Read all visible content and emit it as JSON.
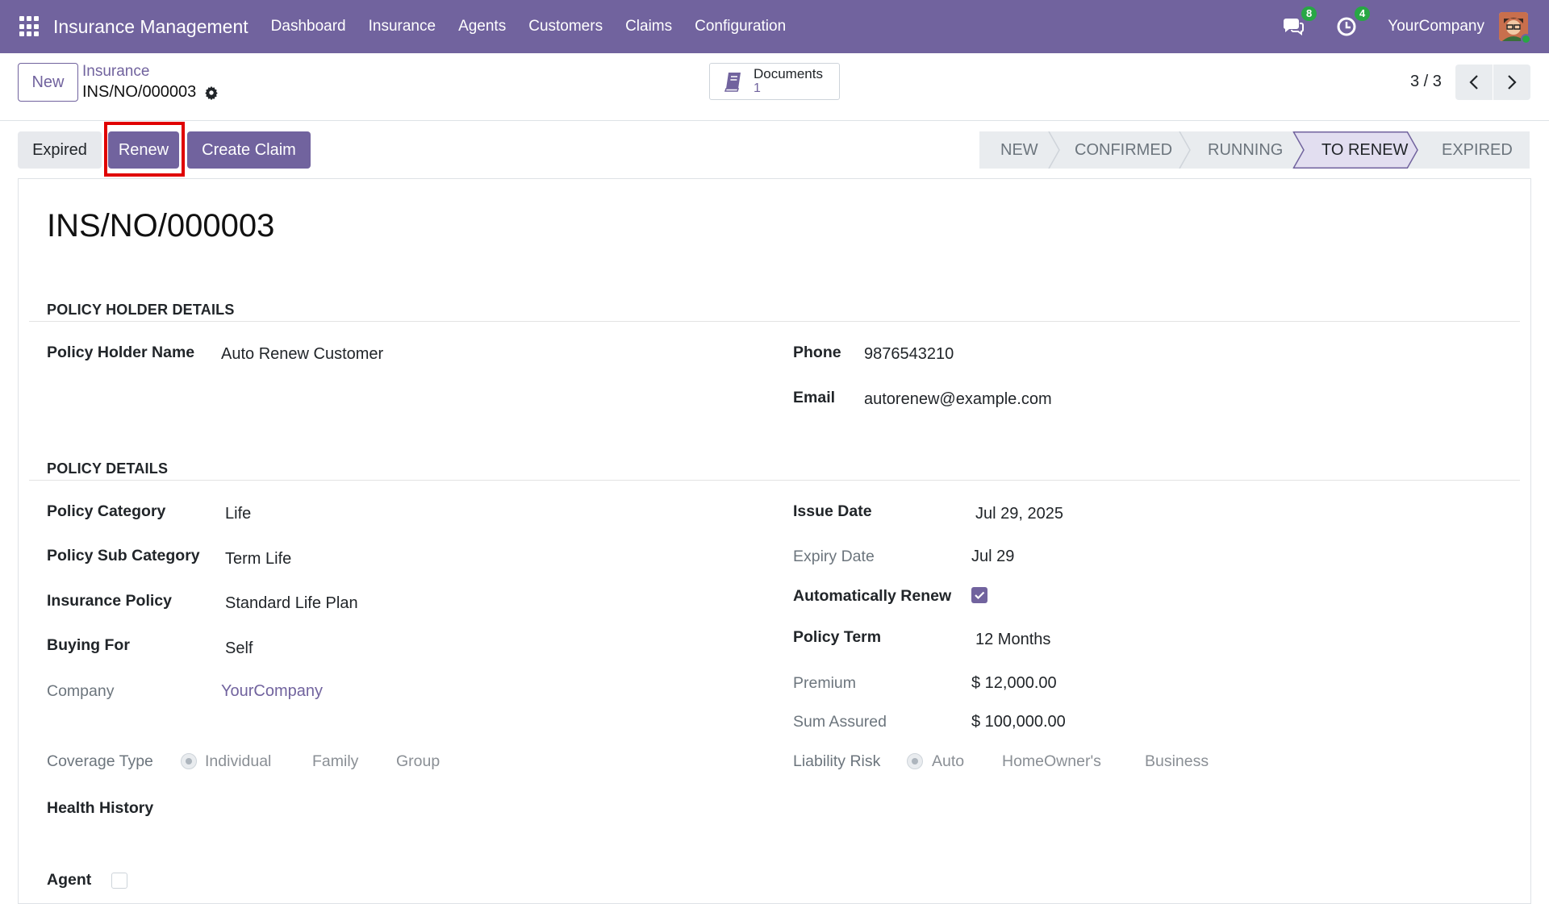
{
  "navbar": {
    "brand": "Insurance Management",
    "menu": [
      "Dashboard",
      "Insurance",
      "Agents",
      "Customers",
      "Claims",
      "Configuration"
    ],
    "messages_count": "8",
    "activities_count": "4",
    "company": "YourCompany"
  },
  "control": {
    "new_label": "New",
    "breadcrumb": "Insurance",
    "record_name": "INS/NO/000003",
    "documents_label": "Documents",
    "documents_count": "1",
    "pager": "3 / 3"
  },
  "actions": {
    "expired": "Expired",
    "renew": "Renew",
    "create_claim": "Create Claim"
  },
  "statusbar": {
    "stages": [
      "NEW",
      "CONFIRMED",
      "RUNNING",
      "TO RENEW",
      "EXPIRED"
    ],
    "active": "TO RENEW"
  },
  "form": {
    "title": "INS/NO/000003",
    "policy_holder_section": "POLICY HOLDER DETAILS",
    "holder_name_label": "Policy Holder Name",
    "holder_name": "Auto Renew Customer",
    "phone_label": "Phone",
    "phone": "9876543210",
    "email_label": "Email",
    "email": "autorenew@example.com",
    "policy_section": "POLICY DETAILS",
    "category_label": "Policy Category",
    "category": "Life",
    "sub_category_label": "Policy Sub Category",
    "sub_category": "Term Life",
    "insurance_policy_label": "Insurance Policy",
    "insurance_policy": "Standard Life Plan",
    "buying_for_label": "Buying For",
    "buying_for": "Self",
    "company_label": "Company",
    "company": "YourCompany",
    "issue_date_label": "Issue Date",
    "issue_date": "Jul 29, 2025",
    "expiry_date_label": "Expiry Date",
    "expiry_date": "Jul 29",
    "auto_renew_label": "Automatically Renew",
    "auto_renew": true,
    "policy_term_label": "Policy Term",
    "policy_term": "12 Months",
    "premium_label": "Premium",
    "premium": "$ 12,000.00",
    "sum_assured_label": "Sum Assured",
    "sum_assured": "$ 100,000.00",
    "coverage_type_label": "Coverage Type",
    "coverage_options": [
      "Individual",
      "Family",
      "Group"
    ],
    "liability_risk_label": "Liability Risk",
    "liability_options": [
      "Auto",
      "HomeOwner's",
      "Business"
    ],
    "health_history_label": "Health History",
    "agent_label": "Agent"
  }
}
